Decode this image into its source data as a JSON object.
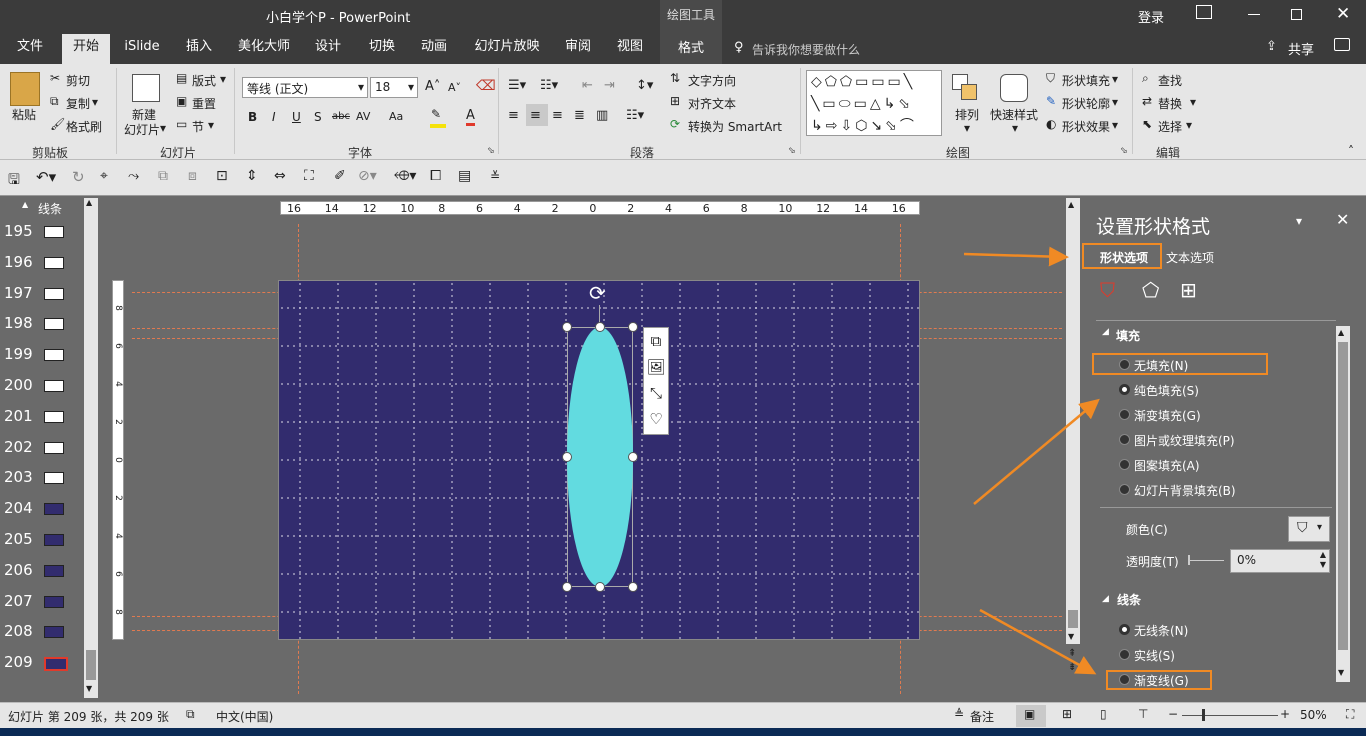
{
  "window": {
    "title": "小白学个P - PowerPoint",
    "context_tab": "绘图工具",
    "login": "登录"
  },
  "tabs": [
    {
      "label": "文件",
      "active": false
    },
    {
      "label": "开始",
      "active": true
    },
    {
      "label": "iSlide",
      "active": false
    },
    {
      "label": "插入",
      "active": false
    },
    {
      "label": "美化大师",
      "active": false
    },
    {
      "label": "设计",
      "active": false
    },
    {
      "label": "切换",
      "active": false
    },
    {
      "label": "动画",
      "active": false
    },
    {
      "label": "幻灯片放映",
      "active": false
    },
    {
      "label": "审阅",
      "active": false
    },
    {
      "label": "视图",
      "active": false
    },
    {
      "label": "格式",
      "active": false
    }
  ],
  "tell_me": "告诉我你想要做什么",
  "share": "共享",
  "ribbon": {
    "clipboard": {
      "paste": "粘贴",
      "cut": "剪切",
      "copy": "复制",
      "format_painter": "格式刷",
      "group": "剪贴板"
    },
    "slides": {
      "new_slide": "新建",
      "new_slide2": "幻灯片",
      "layout": "版式",
      "reset": "重置",
      "section": "节",
      "group": "幻灯片"
    },
    "font": {
      "name": "等线 (正文)",
      "size": "18",
      "bold": "B",
      "italic": "I",
      "underline": "U",
      "shadow": "S",
      "strike": "abc",
      "spacing": "AV",
      "case": "Aa",
      "group": "字体"
    },
    "paragraph": {
      "text_direction": "文字方向",
      "align_text": "对齐文本",
      "smartart": "转换为 SmartArt",
      "group": "段落"
    },
    "drawing": {
      "arrange": "排列",
      "quick_styles": "快速样式",
      "shape_fill": "形状填充",
      "shape_outline": "形状轮廓",
      "shape_effects": "形状效果",
      "group": "绘图"
    },
    "editing": {
      "find": "查找",
      "replace": "替换",
      "select": "选择",
      "group": "编辑"
    }
  },
  "thumbs": {
    "header": "线条",
    "numbers": [
      "195",
      "196",
      "197",
      "198",
      "199",
      "200",
      "201",
      "202",
      "203",
      "204",
      "205",
      "206",
      "207",
      "208",
      "209"
    ]
  },
  "ruler": {
    "h_ticks": [
      "16",
      "14",
      "12",
      "10",
      "8",
      "6",
      "4",
      "2",
      "0",
      "2",
      "4",
      "6",
      "8",
      "10",
      "12",
      "14",
      "16"
    ],
    "v_ticks": [
      "8",
      "6",
      "4",
      "2",
      "0",
      "2",
      "4",
      "6",
      "8"
    ]
  },
  "pane": {
    "title": "设置形状格式",
    "tab_shape": "形状选项",
    "tab_text": "文本选项",
    "fill_header": "填充",
    "fill_options": [
      "无填充(N)",
      "纯色填充(S)",
      "渐变填充(G)",
      "图片或纹理填充(P)",
      "图案填充(A)",
      "幻灯片背景填充(B)"
    ],
    "fill_selected": 1,
    "color_label": "颜色(C)",
    "transparency_label": "透明度(T)",
    "transparency_value": "0%",
    "line_header": "线条",
    "line_options": [
      "无线条(N)",
      "实线(S)",
      "渐变线(G)"
    ],
    "line_selected": 0
  },
  "status": {
    "slide_info": "幻灯片 第 209 张，共 209 张",
    "language": "中文(中国)",
    "notes": "备注",
    "zoom": "50%"
  },
  "colors": {
    "slide_bg": "#322c6e",
    "ellipse": "#62dbe0",
    "accent_orange": "#f08a24",
    "ui_dark": "#3b3b3b"
  }
}
